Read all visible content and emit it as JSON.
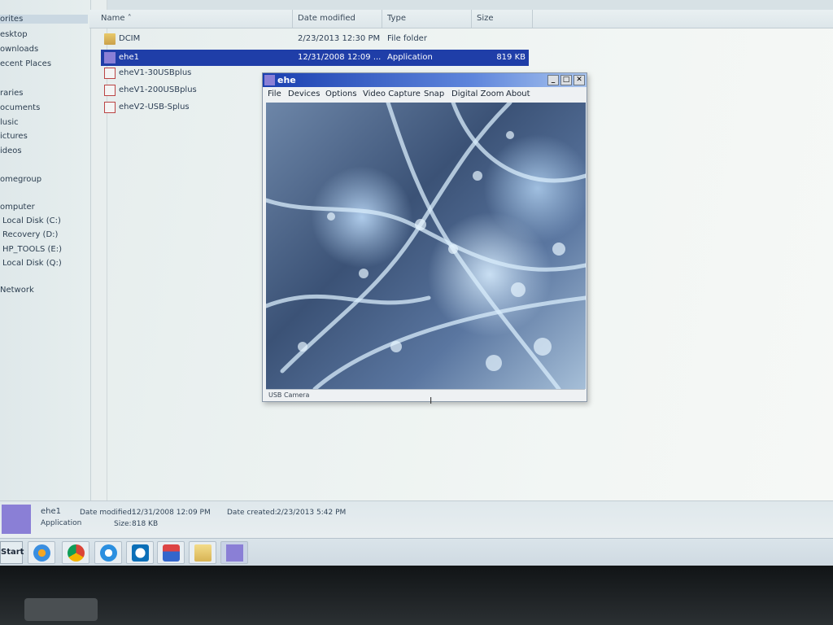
{
  "explorer": {
    "nav_items": [
      "orites",
      "esktop",
      "ownloads",
      "ecent Places",
      "raries",
      "ocuments",
      "lusic",
      "ictures",
      "ideos",
      "omegroup",
      "omputer",
      "Local Disk (C:)",
      "Recovery (D:)",
      "HP_TOOLS (E:)",
      "Local Disk (Q:)",
      "Network"
    ],
    "columns": [
      "Name",
      "Date modified",
      "Type",
      "Size"
    ],
    "files": [
      {
        "name": "DCIM",
        "date": "2/23/2013 12:30 PM",
        "type": "File folder",
        "size": "",
        "icon": "folder-icon"
      },
      {
        "name": "ehe1",
        "date": "12/31/2008 12:09 ...",
        "type": "Application",
        "size": "819 KB",
        "icon": "app-icon"
      },
      {
        "name": "eheV1-30USBplus",
        "date": "",
        "type": "",
        "size": "",
        "icon": "pdf-icon"
      },
      {
        "name": "eheV1-200USBplus",
        "date": "",
        "type": "",
        "size": "",
        "icon": "pdf-icon"
      },
      {
        "name": "eheV2-USB-Splus",
        "date": "",
        "type": "",
        "size": "",
        "icon": "pdf-icon"
      }
    ]
  },
  "app_window": {
    "title": "ehe",
    "menu": [
      "File",
      "Devices",
      "Options",
      "Video Capture",
      "Snap",
      "Digital Zoom",
      "About"
    ],
    "status": "USB Camera",
    "controls": {
      "minimize": "_",
      "maximize": "□",
      "close": "✕"
    }
  },
  "details": {
    "name": "ehe1",
    "kind": "Application",
    "modified_label": "Date modified:",
    "modified_value": "12/31/2008 12:09 PM",
    "size_label": "Size:",
    "size_value": "818 KB",
    "created_label": "Date created:",
    "created_value": "2/23/2013 5:42 PM"
  },
  "taskbar": {
    "start_label": "Start",
    "apps": [
      "media-player-icon",
      "chrome-icon",
      "ie-icon",
      "hp-icon",
      "app-icon-2",
      "folder-icon",
      "ehe-app-icon"
    ]
  }
}
